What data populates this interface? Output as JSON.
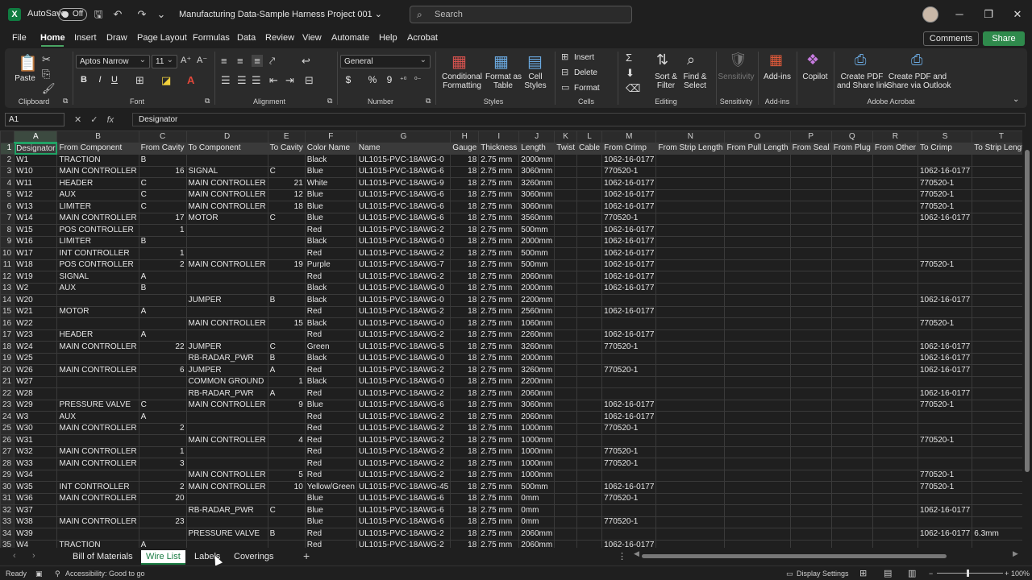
{
  "titlebar": {
    "autosave_label": "AutoSave",
    "autosave_state": "Off",
    "doc_title": "Manufacturing Data-Sample Harness Project 001 ⌄",
    "search_placeholder": "Search",
    "excel_letter": "X"
  },
  "menu": {
    "tabs": [
      "File",
      "Home",
      "Insert",
      "Draw",
      "Page Layout",
      "Formulas",
      "Data",
      "Review",
      "View",
      "Automate",
      "Help",
      "Acrobat"
    ],
    "comments_label": "Comments",
    "share_label": "Share"
  },
  "ribbon": {
    "clipboard": {
      "label": "Clipboard",
      "paste": "Paste"
    },
    "font": {
      "label": "Font",
      "font_name": "Aptos Narrow",
      "font_size": "11",
      "bold": "B",
      "italic": "I",
      "underline": "U"
    },
    "alignment": {
      "label": "Alignment"
    },
    "number": {
      "label": "Number",
      "format": "General",
      "currency": "$",
      "percent": "%",
      "comma": "9"
    },
    "styles": {
      "label": "Styles",
      "conditional": "Conditional\nFormatting",
      "format_table": "Format as\nTable",
      "cell_styles": "Cell\nStyles"
    },
    "cells": {
      "label": "Cells",
      "insert": "Insert",
      "delete": "Delete",
      "format": "Format"
    },
    "editing": {
      "label": "Editing",
      "sort_filter": "Sort &\nFilter",
      "find_select": "Find &\nSelect"
    },
    "sensitivity": {
      "label": "Sensitivity",
      "button": "Sensitivity"
    },
    "addins": {
      "label": "Add-ins",
      "button": "Add-ins"
    },
    "copilot": {
      "button": "Copilot"
    },
    "acrobat": {
      "label": "Adobe Acrobat",
      "create_share": "Create PDF\nand Share link",
      "create_outlook": "Create PDF and\nShare via Outlook"
    }
  },
  "formula_bar": {
    "cell_ref": "A1",
    "fx": "fx",
    "content": "Designator"
  },
  "grid": {
    "columns": [
      "A",
      "B",
      "C",
      "D",
      "E",
      "F",
      "G",
      "H",
      "I",
      "J",
      "K",
      "L",
      "M",
      "N",
      "O",
      "P",
      "Q",
      "R",
      "S",
      "T"
    ],
    "header": [
      "Designator",
      "From Component",
      "From Cavity",
      "To Component",
      "To Cavity",
      "Color Name",
      "Name",
      "Gauge",
      "Thickness",
      "Length",
      "Twist",
      "Cable",
      "From Crimp",
      "From Strip Length",
      "From Pull Length",
      "From Seal",
      "From Plug",
      "From Other",
      "To Crimp",
      "To Strip Length"
    ],
    "rows": [
      [
        "W1",
        "TRACTION",
        "B",
        "",
        "",
        "Black",
        "UL1015-PVC-18AWG-0",
        "18",
        "2.75 mm",
        "2000mm",
        "",
        "",
        "1062-16-0177",
        "",
        "",
        "",
        "",
        "",
        "",
        ""
      ],
      [
        "W10",
        "MAIN CONTROLLER",
        "16",
        "SIGNAL",
        "C",
        "Blue",
        "UL1015-PVC-18AWG-6",
        "18",
        "2.75 mm",
        "3060mm",
        "",
        "",
        "770520-1",
        "",
        "",
        "",
        "",
        "",
        "1062-16-0177",
        ""
      ],
      [
        "W11",
        "HEADER",
        "C",
        "MAIN CONTROLLER",
        "21",
        "White",
        "UL1015-PVC-18AWG-9",
        "18",
        "2.75 mm",
        "3260mm",
        "",
        "",
        "1062-16-0177",
        "",
        "",
        "",
        "",
        "",
        "770520-1",
        ""
      ],
      [
        "W12",
        "AUX",
        "C",
        "MAIN CONTROLLER",
        "12",
        "Blue",
        "UL1015-PVC-18AWG-6",
        "18",
        "2.75 mm",
        "3060mm",
        "",
        "",
        "1062-16-0177",
        "",
        "",
        "",
        "",
        "",
        "770520-1",
        ""
      ],
      [
        "W13",
        "LIMITER",
        "C",
        "MAIN CONTROLLER",
        "18",
        "Blue",
        "UL1015-PVC-18AWG-6",
        "18",
        "2.75 mm",
        "3060mm",
        "",
        "",
        "1062-16-0177",
        "",
        "",
        "",
        "",
        "",
        "770520-1",
        ""
      ],
      [
        "W14",
        "MAIN CONTROLLER",
        "17",
        "MOTOR",
        "C",
        "Blue",
        "UL1015-PVC-18AWG-6",
        "18",
        "2.75 mm",
        "3560mm",
        "",
        "",
        "770520-1",
        "",
        "",
        "",
        "",
        "",
        "1062-16-0177",
        ""
      ],
      [
        "W15",
        "POS CONTROLLER",
        "1",
        "",
        "",
        "Red",
        "UL1015-PVC-18AWG-2",
        "18",
        "2.75 mm",
        "500mm",
        "",
        "",
        "1062-16-0177",
        "",
        "",
        "",
        "",
        "",
        "",
        ""
      ],
      [
        "W16",
        "LIMITER",
        "B",
        "",
        "",
        "Black",
        "UL1015-PVC-18AWG-0",
        "18",
        "2.75 mm",
        "2000mm",
        "",
        "",
        "1062-16-0177",
        "",
        "",
        "",
        "",
        "",
        "",
        ""
      ],
      [
        "W17",
        "INT CONTROLLER",
        "1",
        "",
        "",
        "Red",
        "UL1015-PVC-18AWG-2",
        "18",
        "2.75 mm",
        "500mm",
        "",
        "",
        "1062-16-0177",
        "",
        "",
        "",
        "",
        "",
        "",
        ""
      ],
      [
        "W18",
        "POS CONTROLLER",
        "2",
        "MAIN CONTROLLER",
        "19",
        "Purple",
        "UL1015-PVC-18AWG-7",
        "18",
        "2.75 mm",
        "500mm",
        "",
        "",
        "1062-16-0177",
        "",
        "",
        "",
        "",
        "",
        "770520-1",
        ""
      ],
      [
        "W19",
        "SIGNAL",
        "A",
        "",
        "",
        "Red",
        "UL1015-PVC-18AWG-2",
        "18",
        "2.75 mm",
        "2060mm",
        "",
        "",
        "1062-16-0177",
        "",
        "",
        "",
        "",
        "",
        "",
        ""
      ],
      [
        "W2",
        "AUX",
        "B",
        "",
        "",
        "Black",
        "UL1015-PVC-18AWG-0",
        "18",
        "2.75 mm",
        "2000mm",
        "",
        "",
        "1062-16-0177",
        "",
        "",
        "",
        "",
        "",
        "",
        ""
      ],
      [
        "W20",
        "",
        "",
        "JUMPER",
        "B",
        "Black",
        "UL1015-PVC-18AWG-0",
        "18",
        "2.75 mm",
        "2200mm",
        "",
        "",
        "",
        "",
        "",
        "",
        "",
        "",
        "1062-16-0177",
        ""
      ],
      [
        "W21",
        "MOTOR",
        "A",
        "",
        "",
        "Red",
        "UL1015-PVC-18AWG-2",
        "18",
        "2.75 mm",
        "2560mm",
        "",
        "",
        "1062-16-0177",
        "",
        "",
        "",
        "",
        "",
        "",
        ""
      ],
      [
        "W22",
        "",
        "",
        "MAIN CONTROLLER",
        "15",
        "Black",
        "UL1015-PVC-18AWG-0",
        "18",
        "2.75 mm",
        "1060mm",
        "",
        "",
        "",
        "",
        "",
        "",
        "",
        "",
        "770520-1",
        ""
      ],
      [
        "W23",
        "HEADER",
        "A",
        "",
        "",
        "Red",
        "UL1015-PVC-18AWG-2",
        "18",
        "2.75 mm",
        "2260mm",
        "",
        "",
        "1062-16-0177",
        "",
        "",
        "",
        "",
        "",
        "",
        ""
      ],
      [
        "W24",
        "MAIN CONTROLLER",
        "22",
        "JUMPER",
        "C",
        "Green",
        "UL1015-PVC-18AWG-5",
        "18",
        "2.75 mm",
        "3260mm",
        "",
        "",
        "770520-1",
        "",
        "",
        "",
        "",
        "",
        "1062-16-0177",
        ""
      ],
      [
        "W25",
        "",
        "",
        "RB-RADAR_PWR",
        "B",
        "Black",
        "UL1015-PVC-18AWG-0",
        "18",
        "2.75 mm",
        "2000mm",
        "",
        "",
        "",
        "",
        "",
        "",
        "",
        "",
        "1062-16-0177",
        ""
      ],
      [
        "W26",
        "MAIN CONTROLLER",
        "6",
        "JUMPER",
        "A",
        "Red",
        "UL1015-PVC-18AWG-2",
        "18",
        "2.75 mm",
        "3260mm",
        "",
        "",
        "770520-1",
        "",
        "",
        "",
        "",
        "",
        "1062-16-0177",
        ""
      ],
      [
        "W27",
        "",
        "",
        "COMMON GROUND",
        "1",
        "Black",
        "UL1015-PVC-18AWG-0",
        "18",
        "2.75 mm",
        "2200mm",
        "",
        "",
        "",
        "",
        "",
        "",
        "",
        "",
        "",
        ""
      ],
      [
        "W28",
        "",
        "",
        "RB-RADAR_PWR",
        "A",
        "Red",
        "UL1015-PVC-18AWG-2",
        "18",
        "2.75 mm",
        "2060mm",
        "",
        "",
        "",
        "",
        "",
        "",
        "",
        "",
        "1062-16-0177",
        ""
      ],
      [
        "W29",
        "PRESSURE VALVE",
        "C",
        "MAIN CONTROLLER",
        "9",
        "Blue",
        "UL1015-PVC-18AWG-6",
        "18",
        "2.75 mm",
        "3060mm",
        "",
        "",
        "1062-16-0177",
        "",
        "",
        "",
        "",
        "",
        "770520-1",
        ""
      ],
      [
        "W3",
        "AUX",
        "A",
        "",
        "",
        "Red",
        "UL1015-PVC-18AWG-2",
        "18",
        "2.75 mm",
        "2060mm",
        "",
        "",
        "1062-16-0177",
        "",
        "",
        "",
        "",
        "",
        "",
        ""
      ],
      [
        "W30",
        "MAIN CONTROLLER",
        "2",
        "",
        "",
        "Red",
        "UL1015-PVC-18AWG-2",
        "18",
        "2.75 mm",
        "1000mm",
        "",
        "",
        "770520-1",
        "",
        "",
        "",
        "",
        "",
        "",
        ""
      ],
      [
        "W31",
        "",
        "",
        "MAIN CONTROLLER",
        "4",
        "Red",
        "UL1015-PVC-18AWG-2",
        "18",
        "2.75 mm",
        "1000mm",
        "",
        "",
        "",
        "",
        "",
        "",
        "",
        "",
        "770520-1",
        ""
      ],
      [
        "W32",
        "MAIN CONTROLLER",
        "1",
        "",
        "",
        "Red",
        "UL1015-PVC-18AWG-2",
        "18",
        "2.75 mm",
        "1000mm",
        "",
        "",
        "770520-1",
        "",
        "",
        "",
        "",
        "",
        "",
        ""
      ],
      [
        "W33",
        "MAIN CONTROLLER",
        "3",
        "",
        "",
        "Red",
        "UL1015-PVC-18AWG-2",
        "18",
        "2.75 mm",
        "1000mm",
        "",
        "",
        "770520-1",
        "",
        "",
        "",
        "",
        "",
        "",
        ""
      ],
      [
        "W34",
        "",
        "",
        "MAIN CONTROLLER",
        "5",
        "Red",
        "UL1015-PVC-18AWG-2",
        "18",
        "2.75 mm",
        "1000mm",
        "",
        "",
        "",
        "",
        "",
        "",
        "",
        "",
        "770520-1",
        ""
      ],
      [
        "W35",
        "INT CONTROLLER",
        "2",
        "MAIN CONTROLLER",
        "10",
        "Yellow/Green",
        "UL1015-PVC-18AWG-45",
        "18",
        "2.75 mm",
        "500mm",
        "",
        "",
        "1062-16-0177",
        "",
        "",
        "",
        "",
        "",
        "770520-1",
        ""
      ],
      [
        "W36",
        "MAIN CONTROLLER",
        "20",
        "",
        "",
        "Blue",
        "UL1015-PVC-18AWG-6",
        "18",
        "2.75 mm",
        "0mm",
        "",
        "",
        "770520-1",
        "",
        "",
        "",
        "",
        "",
        "",
        ""
      ],
      [
        "W37",
        "",
        "",
        "RB-RADAR_PWR",
        "C",
        "Blue",
        "UL1015-PVC-18AWG-6",
        "18",
        "2.75 mm",
        "0mm",
        "",
        "",
        "",
        "",
        "",
        "",
        "",
        "",
        "1062-16-0177",
        ""
      ],
      [
        "W38",
        "MAIN CONTROLLER",
        "23",
        "",
        "",
        "Blue",
        "UL1015-PVC-18AWG-6",
        "18",
        "2.75 mm",
        "0mm",
        "",
        "",
        "770520-1",
        "",
        "",
        "",
        "",
        "",
        "",
        ""
      ],
      [
        "W39",
        "",
        "",
        "PRESSURE VALVE",
        "B",
        "Red",
        "UL1015-PVC-18AWG-2",
        "18",
        "2.75 mm",
        "2060mm",
        "",
        "",
        "",
        "",
        "",
        "",
        "",
        "",
        "1062-16-0177",
        "6.3mm"
      ],
      [
        "W4",
        "TRACTION",
        "A",
        "",
        "",
        "Red",
        "UL1015-PVC-18AWG-2",
        "18",
        "2.75 mm",
        "2060mm",
        "",
        "",
        "1062-16-0177",
        "",
        "",
        "",
        "",
        "",
        "",
        ""
      ]
    ]
  },
  "sheet_tabs": [
    "Bill of Materials",
    "Wire List",
    "Labels",
    "Coverings"
  ],
  "active_sheet": "Wire List",
  "status": {
    "ready": "Ready",
    "accessibility": "Accessibility: Good to go",
    "display_settings": "Display Settings",
    "zoom": "100%"
  },
  "colors": {
    "accent_green": "#21a366",
    "background": "#1f1f1f",
    "ribbon": "#2b2b2b"
  }
}
